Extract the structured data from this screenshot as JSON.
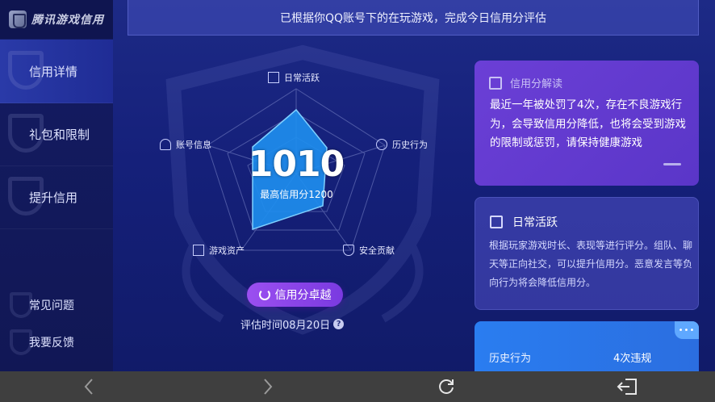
{
  "app": {
    "name": "腾讯游戏信用"
  },
  "sidebar": {
    "items": [
      {
        "label": "信用详情"
      },
      {
        "label": "礼包和限制"
      },
      {
        "label": "提升信用"
      }
    ],
    "bottom": [
      {
        "label": "常见问题"
      },
      {
        "label": "我要反馈"
      }
    ]
  },
  "banner": {
    "text": "已根据你QQ账号下的在玩游戏，完成今日信用分评估"
  },
  "radar": {
    "score": "1010",
    "max_text": "最高信用分1200",
    "axes": [
      {
        "label": "日常活跃",
        "icon": "calendar-icon"
      },
      {
        "label": "历史行为",
        "icon": "clock-icon"
      },
      {
        "label": "安全贡献",
        "icon": "shield-icon"
      },
      {
        "label": "游戏资产",
        "icon": "asset-icon"
      },
      {
        "label": "账号信息",
        "icon": "user-icon"
      }
    ],
    "level_button": "信用分卓越",
    "eval_time": "评估时间08月20日",
    "help_mark": "?"
  },
  "cards": {
    "interpret": {
      "title": "信用分解读",
      "text": "最近一年被处罚了4次，存在不良游戏行为，会导致信用分降低，也将会受到游戏的限制或惩罚，请保持健康游戏"
    },
    "daily": {
      "title": "日常活跃",
      "text": "根据玩家游戏时长、表现等进行评分。组队、聊天等正向社交，可以提升信用分。恶意发言等负向行为将会降低信用分。"
    },
    "history": {
      "label": "历史行为",
      "value": "4次违规",
      "corner": "•••"
    }
  },
  "colors": {
    "background": "#15207a",
    "accent": "#7a3ae0",
    "radar_fill": "#1e90ff",
    "card_purple": "#5a36c8"
  }
}
